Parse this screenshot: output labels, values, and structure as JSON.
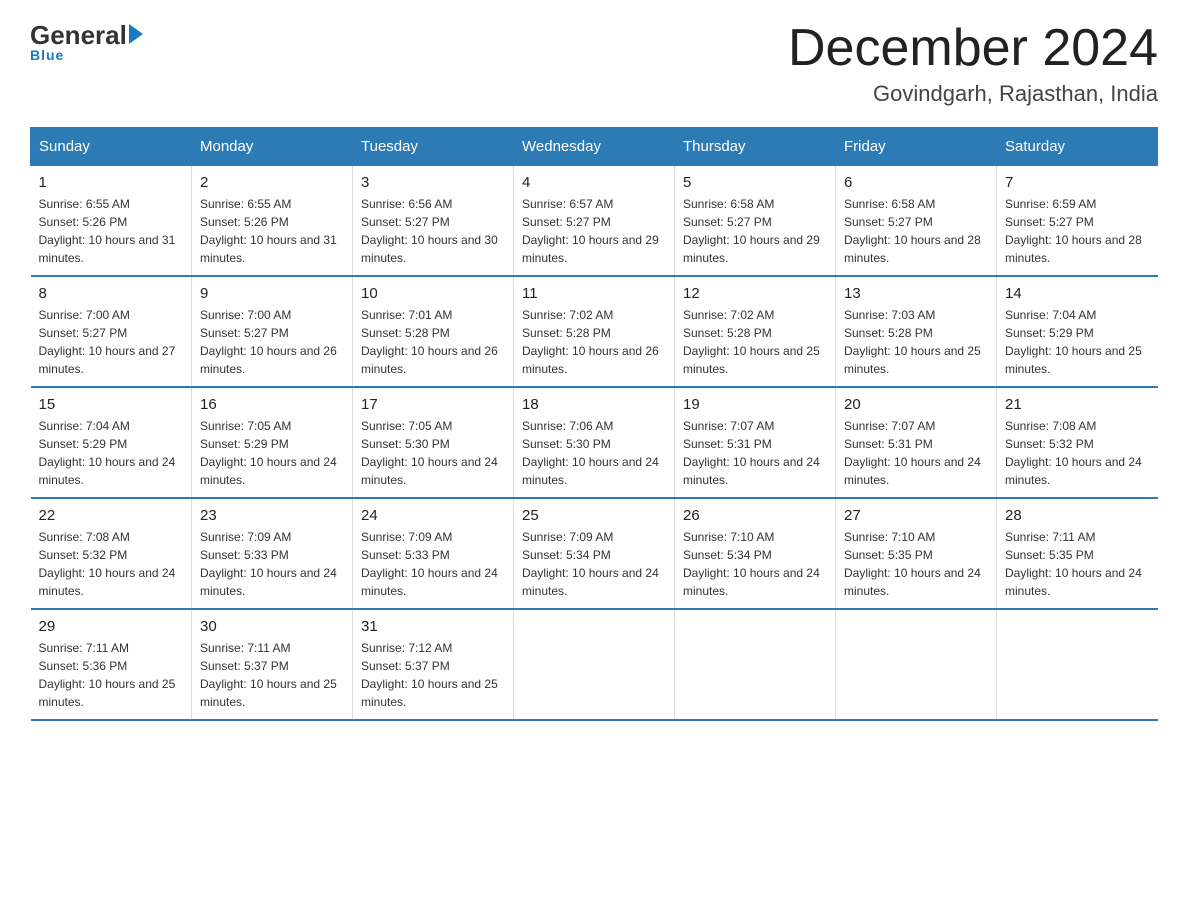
{
  "header": {
    "logo_general": "General",
    "logo_blue": "Blue",
    "month_title": "December 2024",
    "location": "Govindgarh, Rajasthan, India"
  },
  "days_of_week": [
    "Sunday",
    "Monday",
    "Tuesday",
    "Wednesday",
    "Thursday",
    "Friday",
    "Saturday"
  ],
  "weeks": [
    [
      {
        "num": "1",
        "sunrise": "6:55 AM",
        "sunset": "5:26 PM",
        "daylight": "10 hours and 31 minutes."
      },
      {
        "num": "2",
        "sunrise": "6:55 AM",
        "sunset": "5:26 PM",
        "daylight": "10 hours and 31 minutes."
      },
      {
        "num": "3",
        "sunrise": "6:56 AM",
        "sunset": "5:27 PM",
        "daylight": "10 hours and 30 minutes."
      },
      {
        "num": "4",
        "sunrise": "6:57 AM",
        "sunset": "5:27 PM",
        "daylight": "10 hours and 29 minutes."
      },
      {
        "num": "5",
        "sunrise": "6:58 AM",
        "sunset": "5:27 PM",
        "daylight": "10 hours and 29 minutes."
      },
      {
        "num": "6",
        "sunrise": "6:58 AM",
        "sunset": "5:27 PM",
        "daylight": "10 hours and 28 minutes."
      },
      {
        "num": "7",
        "sunrise": "6:59 AM",
        "sunset": "5:27 PM",
        "daylight": "10 hours and 28 minutes."
      }
    ],
    [
      {
        "num": "8",
        "sunrise": "7:00 AM",
        "sunset": "5:27 PM",
        "daylight": "10 hours and 27 minutes."
      },
      {
        "num": "9",
        "sunrise": "7:00 AM",
        "sunset": "5:27 PM",
        "daylight": "10 hours and 26 minutes."
      },
      {
        "num": "10",
        "sunrise": "7:01 AM",
        "sunset": "5:28 PM",
        "daylight": "10 hours and 26 minutes."
      },
      {
        "num": "11",
        "sunrise": "7:02 AM",
        "sunset": "5:28 PM",
        "daylight": "10 hours and 26 minutes."
      },
      {
        "num": "12",
        "sunrise": "7:02 AM",
        "sunset": "5:28 PM",
        "daylight": "10 hours and 25 minutes."
      },
      {
        "num": "13",
        "sunrise": "7:03 AM",
        "sunset": "5:28 PM",
        "daylight": "10 hours and 25 minutes."
      },
      {
        "num": "14",
        "sunrise": "7:04 AM",
        "sunset": "5:29 PM",
        "daylight": "10 hours and 25 minutes."
      }
    ],
    [
      {
        "num": "15",
        "sunrise": "7:04 AM",
        "sunset": "5:29 PM",
        "daylight": "10 hours and 24 minutes."
      },
      {
        "num": "16",
        "sunrise": "7:05 AM",
        "sunset": "5:29 PM",
        "daylight": "10 hours and 24 minutes."
      },
      {
        "num": "17",
        "sunrise": "7:05 AM",
        "sunset": "5:30 PM",
        "daylight": "10 hours and 24 minutes."
      },
      {
        "num": "18",
        "sunrise": "7:06 AM",
        "sunset": "5:30 PM",
        "daylight": "10 hours and 24 minutes."
      },
      {
        "num": "19",
        "sunrise": "7:07 AM",
        "sunset": "5:31 PM",
        "daylight": "10 hours and 24 minutes."
      },
      {
        "num": "20",
        "sunrise": "7:07 AM",
        "sunset": "5:31 PM",
        "daylight": "10 hours and 24 minutes."
      },
      {
        "num": "21",
        "sunrise": "7:08 AM",
        "sunset": "5:32 PM",
        "daylight": "10 hours and 24 minutes."
      }
    ],
    [
      {
        "num": "22",
        "sunrise": "7:08 AM",
        "sunset": "5:32 PM",
        "daylight": "10 hours and 24 minutes."
      },
      {
        "num": "23",
        "sunrise": "7:09 AM",
        "sunset": "5:33 PM",
        "daylight": "10 hours and 24 minutes."
      },
      {
        "num": "24",
        "sunrise": "7:09 AM",
        "sunset": "5:33 PM",
        "daylight": "10 hours and 24 minutes."
      },
      {
        "num": "25",
        "sunrise": "7:09 AM",
        "sunset": "5:34 PM",
        "daylight": "10 hours and 24 minutes."
      },
      {
        "num": "26",
        "sunrise": "7:10 AM",
        "sunset": "5:34 PM",
        "daylight": "10 hours and 24 minutes."
      },
      {
        "num": "27",
        "sunrise": "7:10 AM",
        "sunset": "5:35 PM",
        "daylight": "10 hours and 24 minutes."
      },
      {
        "num": "28",
        "sunrise": "7:11 AM",
        "sunset": "5:35 PM",
        "daylight": "10 hours and 24 minutes."
      }
    ],
    [
      {
        "num": "29",
        "sunrise": "7:11 AM",
        "sunset": "5:36 PM",
        "daylight": "10 hours and 25 minutes."
      },
      {
        "num": "30",
        "sunrise": "7:11 AM",
        "sunset": "5:37 PM",
        "daylight": "10 hours and 25 minutes."
      },
      {
        "num": "31",
        "sunrise": "7:12 AM",
        "sunset": "5:37 PM",
        "daylight": "10 hours and 25 minutes."
      },
      null,
      null,
      null,
      null
    ]
  ]
}
